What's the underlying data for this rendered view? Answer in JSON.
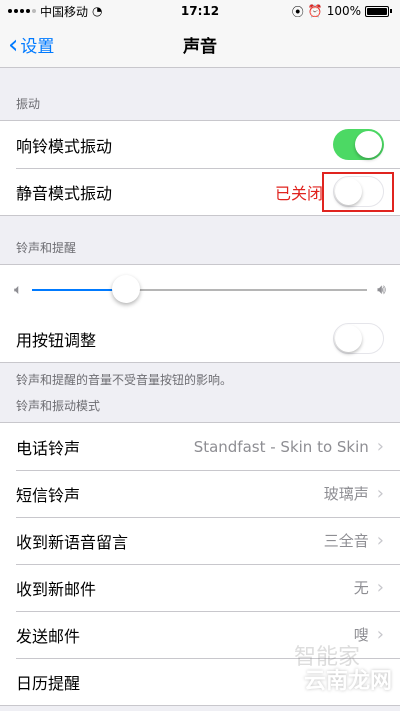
{
  "status_bar": {
    "carrier": "中国移动",
    "time": "17:12",
    "battery": "100%"
  },
  "nav": {
    "back_label": "设置",
    "title": "声音"
  },
  "vibration": {
    "header": "振动",
    "ring_vibrate": {
      "label": "响铃模式振动",
      "on": true
    },
    "silent_vibrate": {
      "label": "静音模式振动",
      "on": false
    },
    "annotation": "已关闭"
  },
  "ringer": {
    "header": "铃声和提醒",
    "volume_level": 0.28,
    "change_with_buttons": {
      "label": "用按钮调整",
      "on": false
    },
    "footer": "铃声和提醒的音量不受音量按钮的影响。"
  },
  "patterns": {
    "header": "铃声和振动模式",
    "items": [
      {
        "label": "电话铃声",
        "value": "Standfast - Skin to Skin"
      },
      {
        "label": "短信铃声",
        "value": "玻璃声"
      },
      {
        "label": "收到新语音留言",
        "value": "三全音"
      },
      {
        "label": "收到新邮件",
        "value": "无"
      },
      {
        "label": "发送邮件",
        "value": "嗖"
      },
      {
        "label": "日历提醒",
        "value": ""
      }
    ]
  },
  "watermark": {
    "text1": "智能家",
    "text2": "云南龙网"
  },
  "colors": {
    "accent": "#007aff",
    "toggle_on": "#4cd964",
    "annotation": "#e0241f"
  }
}
